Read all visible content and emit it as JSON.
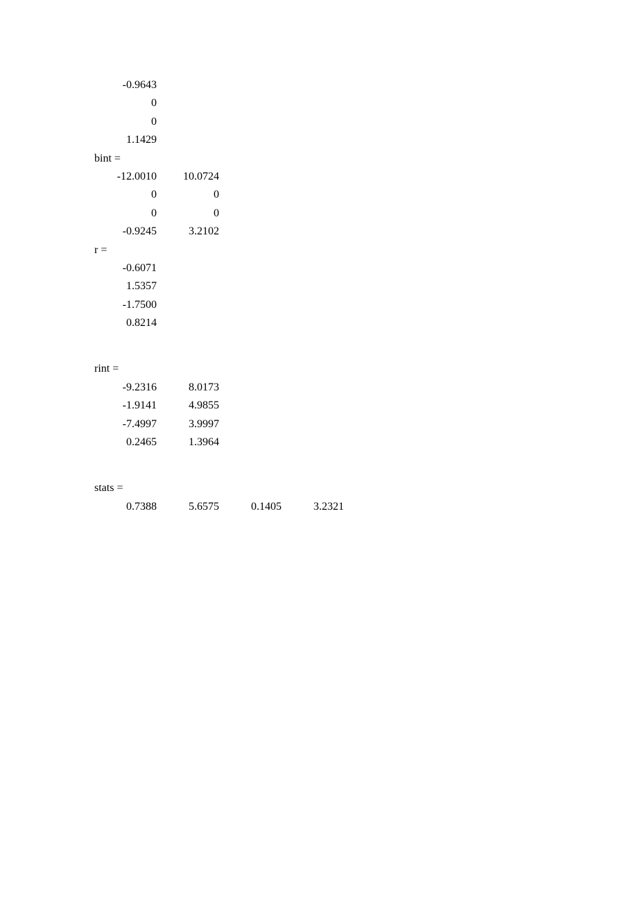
{
  "top_values": [
    "-0.9643",
    "0",
    "0",
    "1.1429"
  ],
  "bint": {
    "label": "bint =",
    "rows": [
      [
        "-12.0010",
        "10.0724"
      ],
      [
        "0",
        "0"
      ],
      [
        "0",
        "0"
      ],
      [
        "-0.9245",
        "3.2102"
      ]
    ]
  },
  "r": {
    "label": "r =",
    "rows": [
      "-0.6071",
      "1.5357",
      "-1.7500",
      "0.8214"
    ]
  },
  "rint": {
    "label": "rint =",
    "rows": [
      [
        "-9.2316",
        "8.0173"
      ],
      [
        "-1.9141",
        "4.9855"
      ],
      [
        "-7.4997",
        "3.9997"
      ],
      [
        "0.2465",
        "1.3964"
      ]
    ]
  },
  "stats": {
    "label": "stats =",
    "row": [
      "0.7388",
      "5.6575",
      "0.1405",
      "3.2321"
    ]
  }
}
